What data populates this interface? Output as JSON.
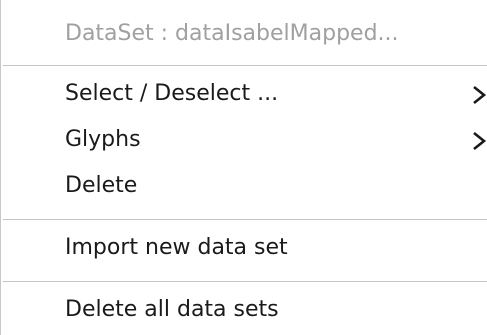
{
  "context_menu": {
    "header": "DataSet : dataIsabelMapped...",
    "items": [
      {
        "label": "Select / Deselect ...",
        "submenu_icon": "chevron-right-icon"
      },
      {
        "label": "Glyphs",
        "submenu_icon": "chevron-right-icon"
      },
      {
        "label": "Delete"
      },
      {
        "label": "Import new data set"
      },
      {
        "label": "Delete all data sets"
      }
    ]
  },
  "colors": {
    "header_text": "#a0a0a0",
    "item_text": "#1a1a1a",
    "separator": "#c4c4c4",
    "background": "#ffffff"
  }
}
